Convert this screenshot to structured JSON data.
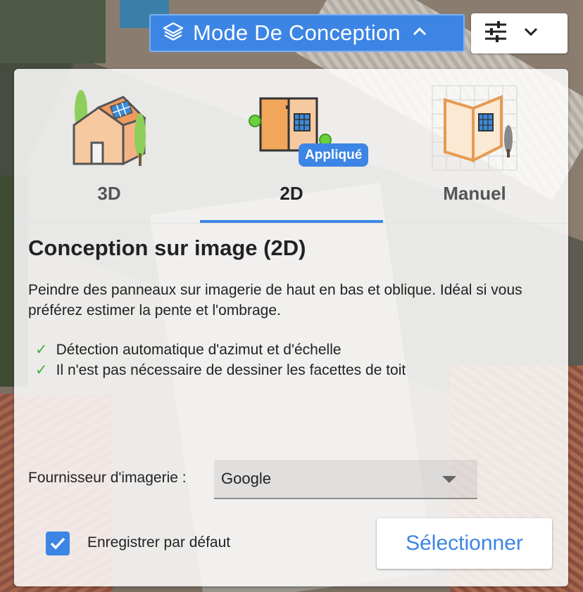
{
  "header": {
    "mode_button_label": "Mode De Conception",
    "mode_button_icon": "layers-icon",
    "mode_caret_icon": "chevron-up-icon",
    "settings_icon": "sliders-icon",
    "settings_caret_icon": "chevron-down-icon"
  },
  "tabs": [
    {
      "label": "3D",
      "icon": "house-3d-icon",
      "active": false
    },
    {
      "label": "2D",
      "icon": "panels-2d-icon",
      "active": true,
      "badge": "Appliqué"
    },
    {
      "label": "Manuel",
      "icon": "manual-grid-icon",
      "active": false
    }
  ],
  "content": {
    "title": "Conception sur image (2D)",
    "description": "Peindre des panneaux sur imagerie de haut en bas et oblique. Idéal si vous préférez estimer la pente et l'ombrage.",
    "features": [
      "Détection automatique d'azimut et d'échelle",
      "Il n'est pas nécessaire de dessiner les facettes de toit"
    ]
  },
  "provider": {
    "label": "Fournisseur d'imagerie :",
    "selected": "Google"
  },
  "default_checkbox": {
    "label": "Enregistrer par défaut",
    "checked": true
  },
  "select_button": "Sélectionner",
  "colors": {
    "accent": "#3c85e4",
    "check": "#3bb33b"
  }
}
